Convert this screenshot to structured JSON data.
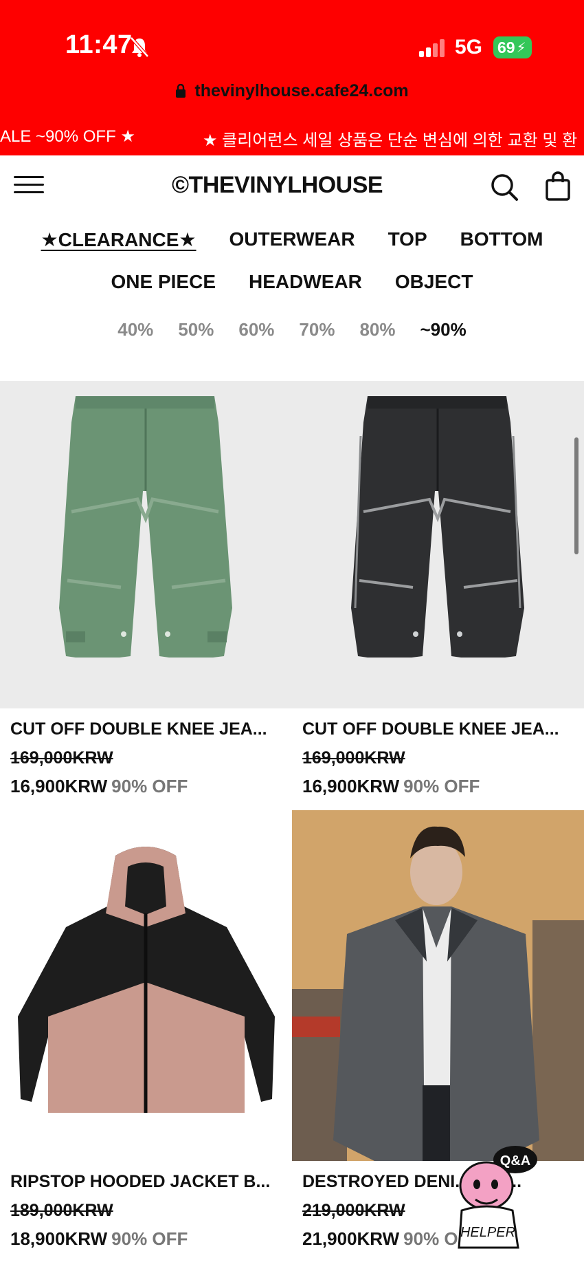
{
  "status": {
    "time": "11:47",
    "network": "5G",
    "battery": "69"
  },
  "browser": {
    "url": "thevinylhouse.cafe24.com"
  },
  "marquee": {
    "left_text": "ALE ~90% OFF ★",
    "right_text": "★ 클리어런스 세일 상품은 단순 변심에 의한 교환 및 환"
  },
  "header": {
    "logo": "©THEVINYLHOUSE"
  },
  "categories": {
    "row1": [
      "★CLEARANCE★",
      "OUTERWEAR",
      "TOP",
      "BOTTOM"
    ],
    "row2": [
      "ONE PIECE",
      "HEADWEAR",
      "OBJECT"
    ]
  },
  "discount_filters": [
    "40%",
    "50%",
    "60%",
    "70%",
    "80%",
    "~90%"
  ],
  "products": [
    {
      "name": "CUT OFF DOUBLE KNEE JEA...",
      "original": "169,000KRW",
      "price": "16,900KRW",
      "off": "90% OFF"
    },
    {
      "name": "CUT OFF DOUBLE KNEE JEA...",
      "original": "169,000KRW",
      "price": "16,900KRW",
      "off": "90% OFF"
    },
    {
      "name": "RIPSTOP HOODED JACKET B...",
      "original": "189,000KRW",
      "price": "18,900KRW",
      "off": "90% OFF"
    },
    {
      "name": "DESTROYED DENI...UP J...",
      "original": "219,000KRW",
      "price": "21,900KRW",
      "off": "90% OFF"
    }
  ],
  "helper": {
    "bubble": "Q&A",
    "label": "HELPER"
  },
  "colors": {
    "top_bar": "#fe0000",
    "battery": "#34c759",
    "green_jeans": "#6b9474",
    "black_jeans": "#2e2f31",
    "jacket_pink": "#c99a8e"
  }
}
